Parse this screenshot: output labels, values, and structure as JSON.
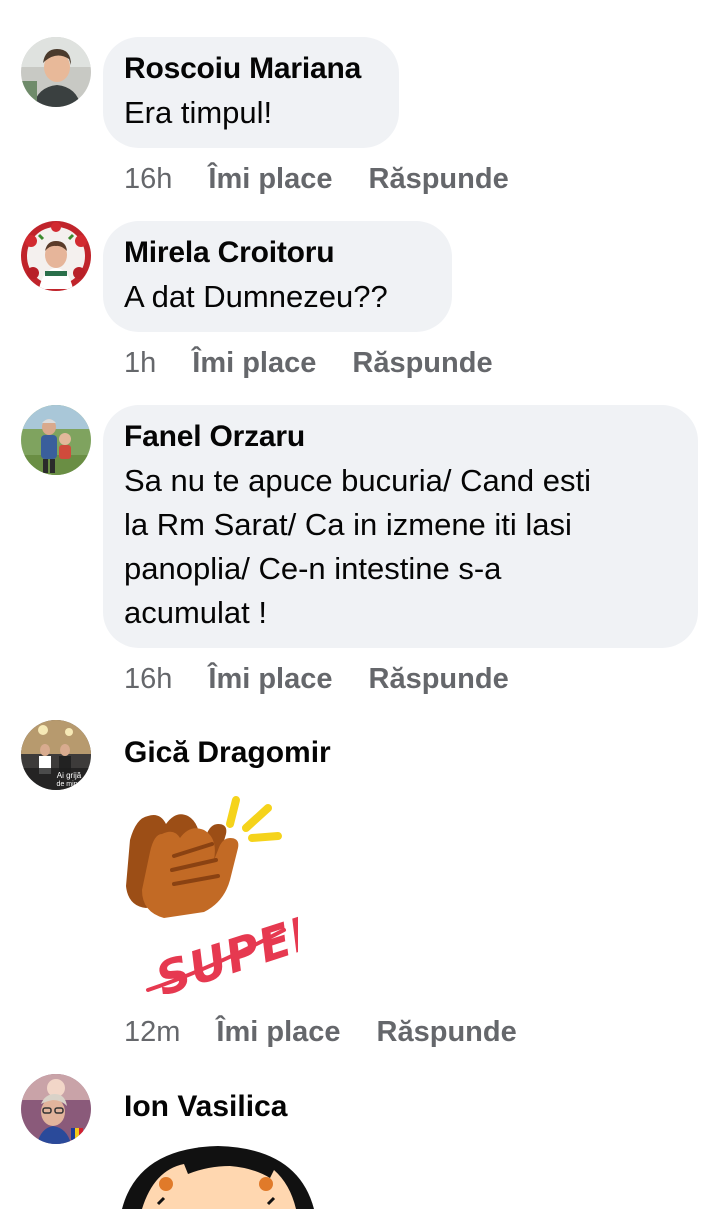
{
  "comments": [
    {
      "author": "Roscoiu Mariana",
      "text": "Era timpul!",
      "time": "16h",
      "like_label": "Îmi place",
      "reply_label": "Răspunde"
    },
    {
      "author": "Mirela Croitoru",
      "text": "A dat Dumnezeu??",
      "time": "1h",
      "like_label": "Îmi place",
      "reply_label": "Răspunde"
    },
    {
      "author": "Fanel Orzaru",
      "text_lines": [
        "Sa nu te apuce bucuria/ Cand esti",
        "la Rm Sarat/ Ca in izmene iti lasi",
        "panoplia/ Ce-n intestine s-a",
        "acumulat !"
      ],
      "time": "16h",
      "like_label": "Îmi place",
      "reply_label": "Răspunde"
    },
    {
      "author": "Gică Dragomir",
      "sticker_text": "SUPER!",
      "avatar_text": [
        "Ai grijă",
        "de mine"
      ],
      "time": "12m",
      "like_label": "Îmi place",
      "reply_label": "Răspunde"
    },
    {
      "author": "Ion Vasilica"
    }
  ],
  "colors": {
    "bubble": "#f0f2f5",
    "meta_text": "#65676b",
    "name_text": "#050505",
    "sticker_red": "#e63950",
    "sticker_yellow": "#f5d31b",
    "sticker_hand": "#b8611f"
  }
}
